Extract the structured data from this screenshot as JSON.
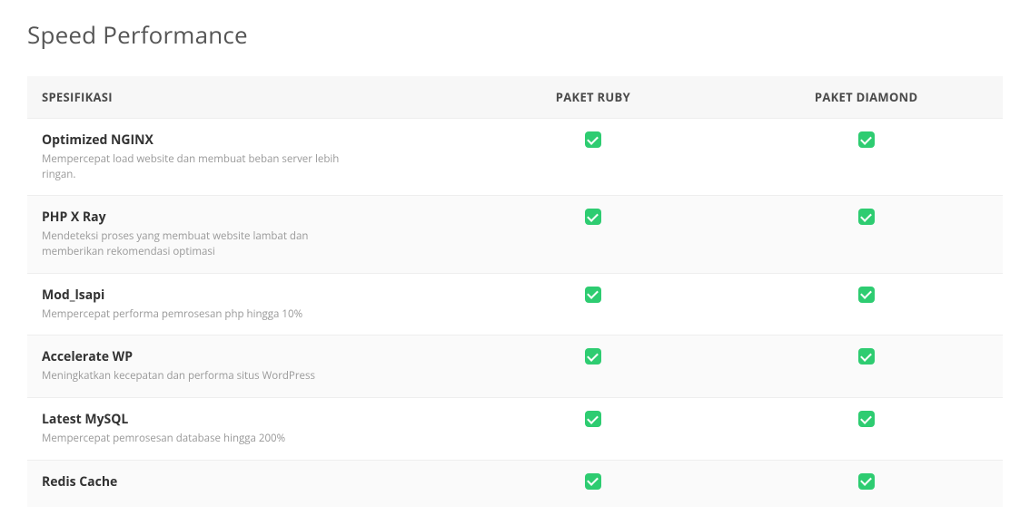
{
  "section_title": "Speed Performance",
  "columns": {
    "spec": "SPESIFIKASI",
    "plan_ruby": "PAKET RUBY",
    "plan_diamond": "PAKET DIAMOND"
  },
  "rows": [
    {
      "title": "Optimized NGINX",
      "desc": "Mempercepat load website dan membuat beban server lebih ringan.",
      "ruby": true,
      "diamond": true
    },
    {
      "title": "PHP X Ray",
      "desc": "Mendeteksi proses yang membuat website lambat dan memberikan rekomendasi optimasi",
      "ruby": true,
      "diamond": true
    },
    {
      "title": "Mod_lsapi",
      "desc": "Mempercepat performa pemrosesan php hingga 10%",
      "ruby": true,
      "diamond": true
    },
    {
      "title": "Accelerate WP",
      "desc": "Meningkatkan kecepatan dan performa situs WordPress",
      "ruby": true,
      "diamond": true
    },
    {
      "title": "Latest MySQL",
      "desc": "Mempercepat pemrosesan database hingga 200%",
      "ruby": true,
      "diamond": true
    },
    {
      "title": "Redis Cache",
      "desc": "",
      "ruby": true,
      "diamond": true
    }
  ]
}
